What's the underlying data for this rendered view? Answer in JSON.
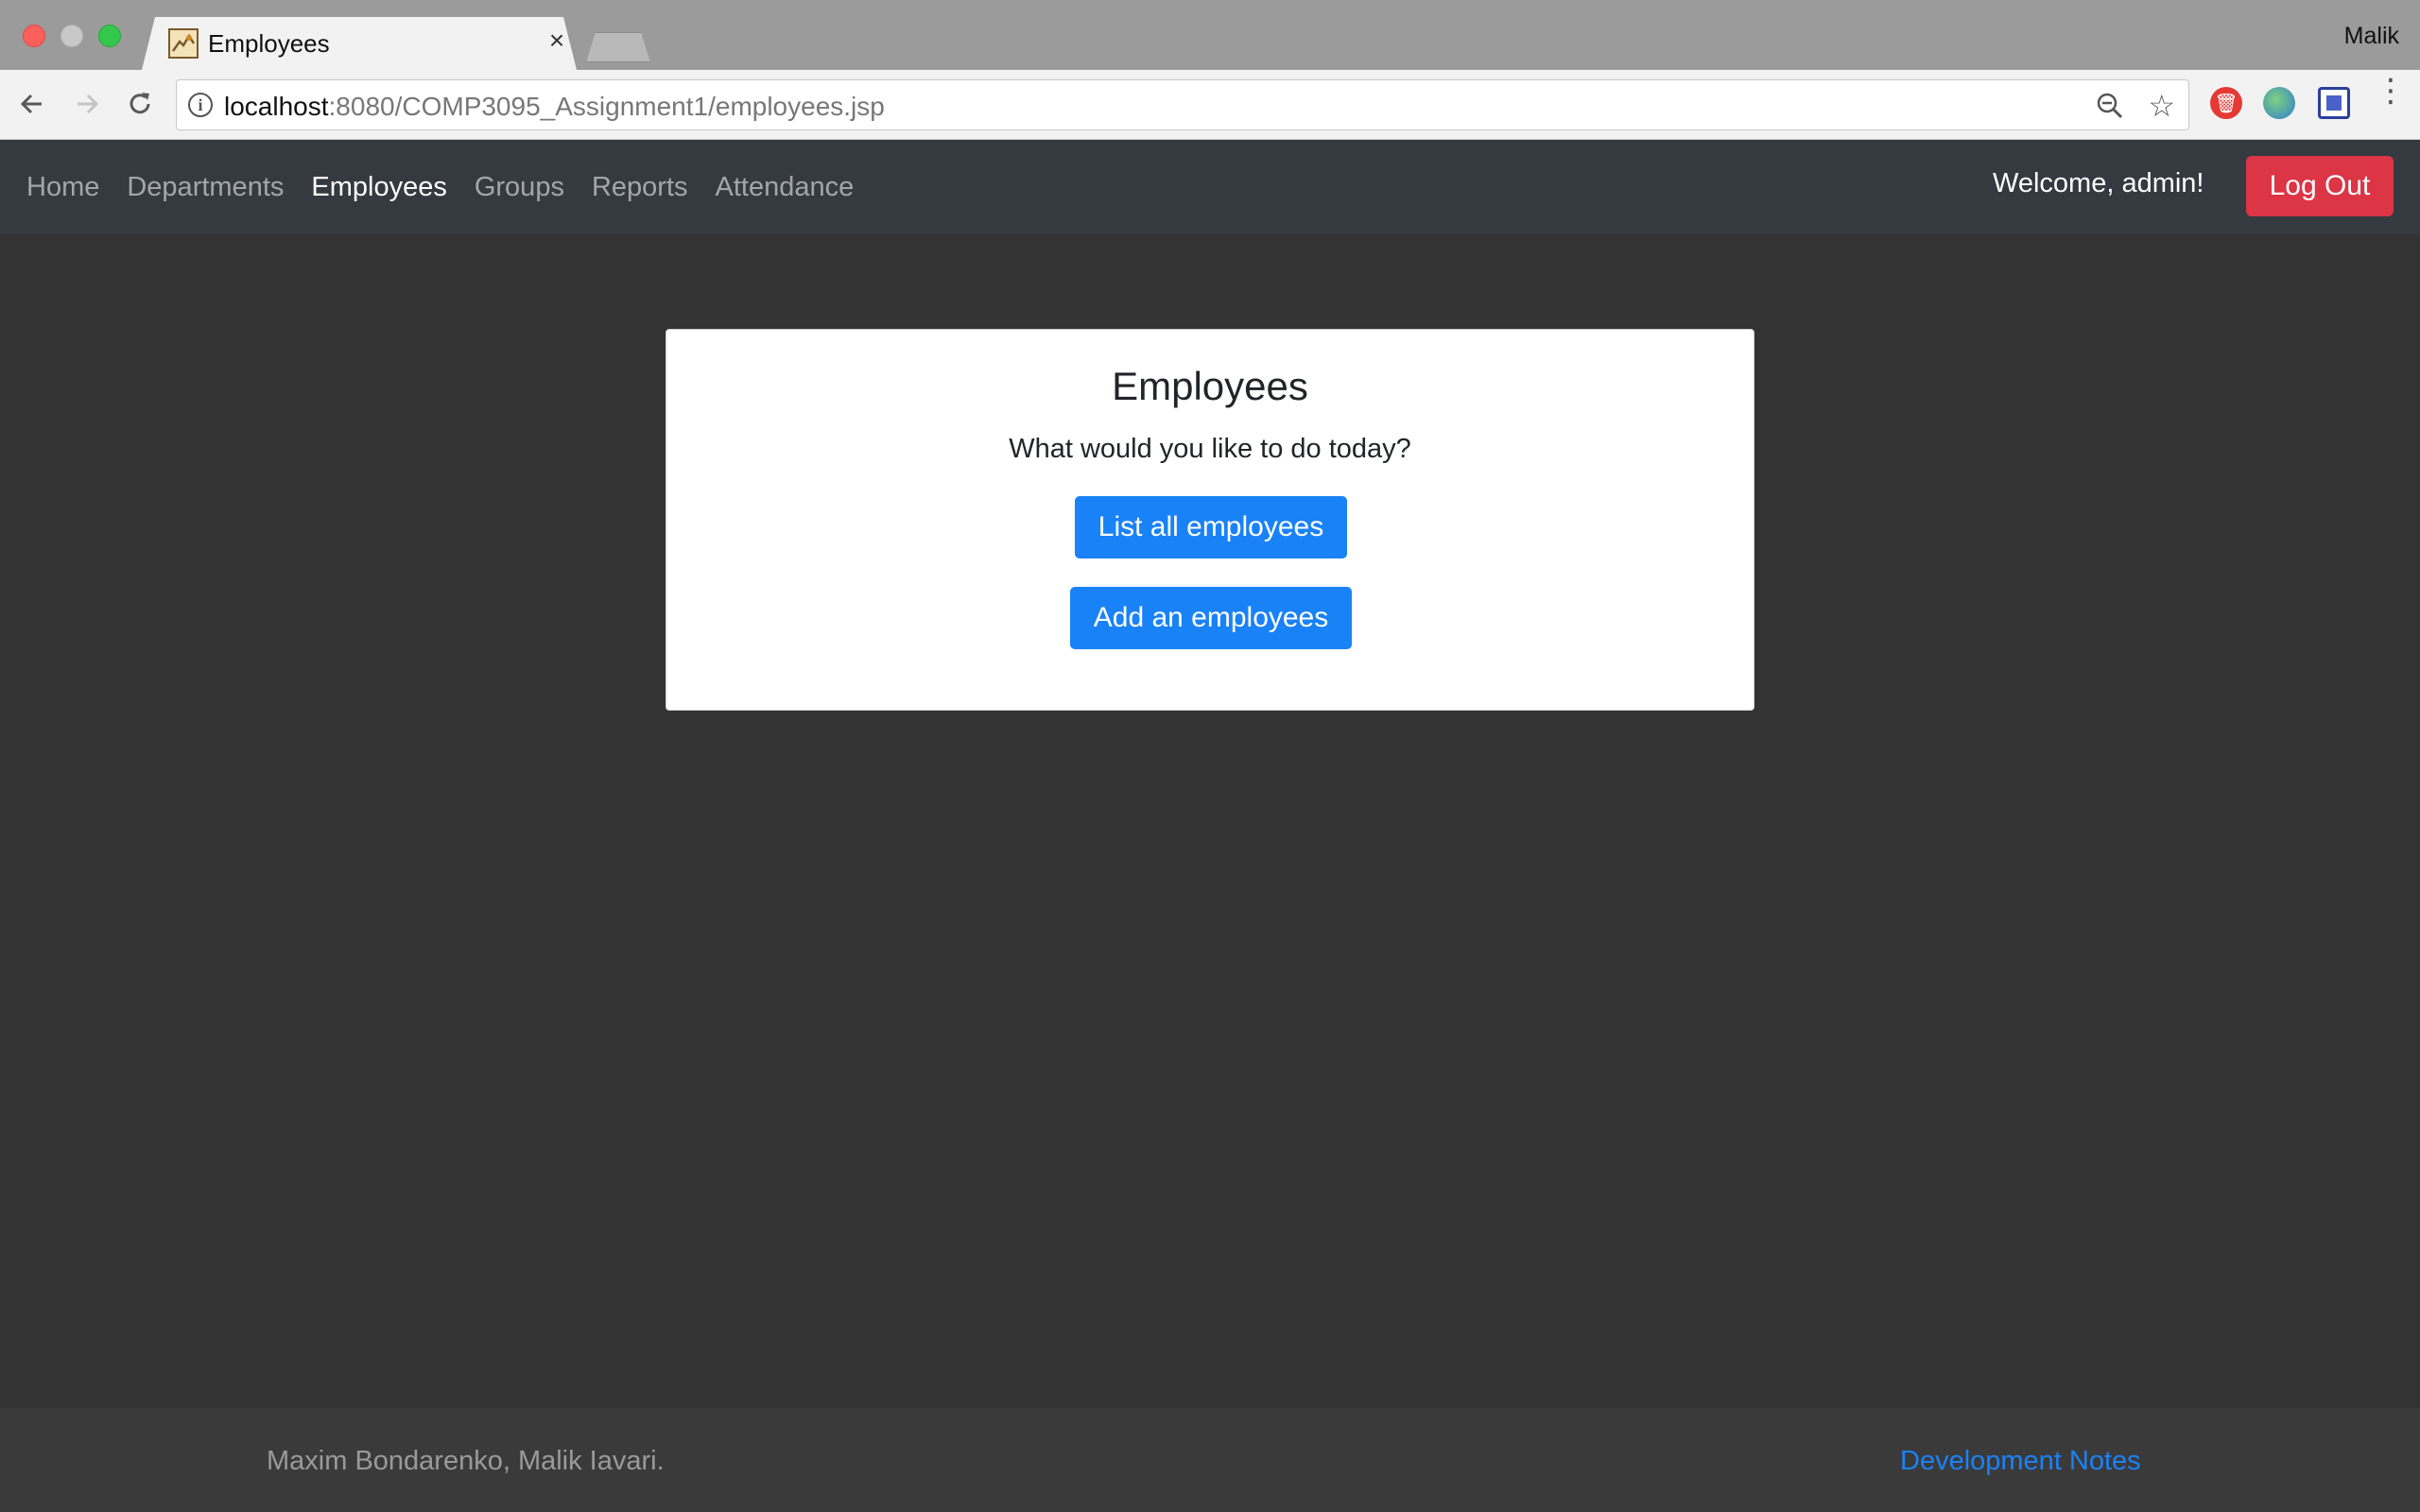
{
  "browser": {
    "tab_title": "Employees",
    "tab_close": "×",
    "profile_name": "Malik",
    "url_host": "localhost",
    "url_rest": ":8080/COMP3095_Assignment1/employees.jsp",
    "icons": {
      "back": "arrow-left-icon",
      "forward": "arrow-right-icon",
      "reload": "reload-icon",
      "info": "info-icon",
      "zoom": "zoom-out-icon",
      "star": "star-icon",
      "menu": "more-vertical-icon"
    }
  },
  "navbar": {
    "links": [
      "Home",
      "Departments",
      "Employees",
      "Groups",
      "Reports",
      "Attendance"
    ],
    "active": "Employees",
    "welcome": "Welcome, admin!",
    "logout_label": "Log Out"
  },
  "card": {
    "title": "Employees",
    "subtitle": "What would you like to do today?",
    "list_button": "List all employees",
    "add_button": "Add an employees"
  },
  "footer": {
    "credit": "Maxim Bondarenko, Malik Iavari.",
    "link": "Development Notes"
  },
  "colors": {
    "navbar_bg": "#343a40",
    "page_bg": "#333333",
    "primary": "#1a82f7",
    "danger": "#dc3545"
  }
}
